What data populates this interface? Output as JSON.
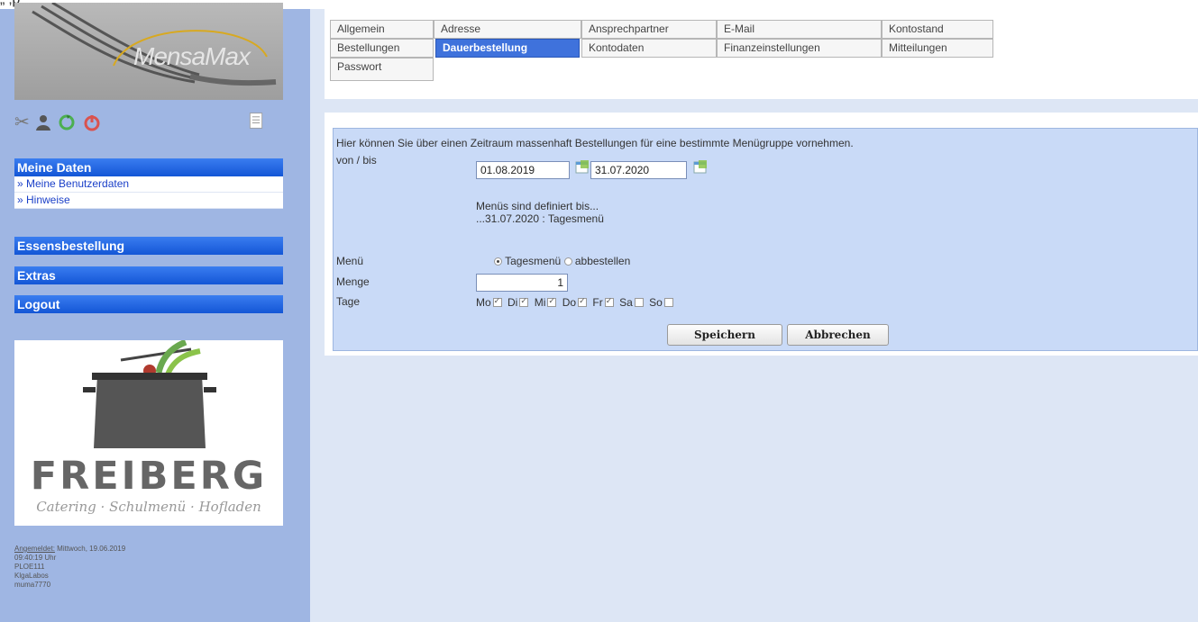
{
  "top_strip_text": "„ ‚p",
  "sidebar": {
    "logo_text": "MensaMax",
    "icons": [
      "tools-icon",
      "user-icon",
      "refresh-icon",
      "power-icon",
      "menu-icon"
    ],
    "nav": {
      "meine_daten": "Meine Daten",
      "items": [
        "» Meine Benutzerdaten",
        "» Hinweise"
      ],
      "essensbestellung": "Essensbestellung",
      "extras": "Extras",
      "logout": "Logout"
    },
    "freiberg": {
      "title": "FREIBERG",
      "subtitle": "Catering · Schulmenü · Hofladen"
    },
    "login_info": {
      "label": "Angemeldet:",
      "datetime": "Mittwoch, 19.06.2019",
      "time": "09:40:19 Uhr",
      "l1": "PLOE111",
      "l2": "KlgaLabos",
      "l3": "muma7770"
    }
  },
  "tabs": [
    {
      "label": "Allgemein"
    },
    {
      "label": "Adresse"
    },
    {
      "label": "Ansprechpartner"
    },
    {
      "label": "E-Mail"
    },
    {
      "label": "Kontostand"
    },
    {
      "label": "Bestellungen"
    },
    {
      "label": "Dauerbestellung",
      "active": true
    },
    {
      "label": "Kontodaten"
    },
    {
      "label": "Finanzeinstellungen"
    },
    {
      "label": "Mitteilungen"
    },
    {
      "label": "Passwort"
    }
  ],
  "form": {
    "intro": "Hier können Sie über einen Zeitraum massenhaft Bestellungen für eine bestimmte Menügruppe vornehmen.",
    "von_bis_label": "von / bis",
    "date_from": "01.08.2019",
    "date_to": "31.07.2020",
    "defined_line1": "Menüs sind definiert bis...",
    "defined_line2": "...31.07.2020 : Tagesmenü",
    "menu_label": "Menü",
    "menu_options": [
      "Tagesmenü",
      "abbestellen"
    ],
    "menu_selected": "Tagesmenü",
    "menge_label": "Menge",
    "menge_value": "1",
    "tage_label": "Tage",
    "days": [
      {
        "label": "Mo",
        "checked": true
      },
      {
        "label": "Di",
        "checked": true
      },
      {
        "label": "Mi",
        "checked": true
      },
      {
        "label": "Do",
        "checked": true
      },
      {
        "label": "Fr",
        "checked": true
      },
      {
        "label": "Sa",
        "checked": false
      },
      {
        "label": "So",
        "checked": false
      }
    ],
    "save_label": "Speichern",
    "cancel_label": "Abbrechen"
  },
  "colors": {
    "nav_blue": "#1356d6",
    "tab_active": "#3f72dc",
    "form_bg": "#c9daf7",
    "sidebar_bg": "#9fb6e3"
  }
}
